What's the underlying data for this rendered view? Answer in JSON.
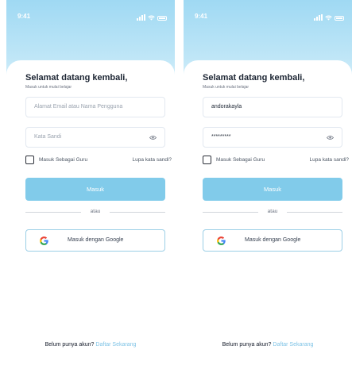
{
  "screens": [
    {
      "status_time": "9:41",
      "title": "Selamat datang kembali,",
      "subtitle": "Masuk untuk mulai belajar",
      "email_value": "",
      "email_placeholder": "Alamat Email atau Nama Pengguna",
      "password_value": "",
      "password_placeholder": "Kata Sandi",
      "teacher_label": "Masuk Sebagai Guru",
      "forgot_label": "Lupa kata sandi?",
      "login_label": "Masuk",
      "or_label": "atau",
      "google_label": "Masuk dengan Google",
      "no_account_text": "Belum punya akun?",
      "register_link": "Daftar Sekarang"
    },
    {
      "status_time": "9:41",
      "title": "Selamat datang kembali,",
      "subtitle": "Masuk untuk mulai belajar",
      "email_value": "andorakayla",
      "email_placeholder": "",
      "password_value": "*********",
      "password_placeholder": "",
      "teacher_label": "Masuk Sebagai Guru",
      "forgot_label": "Lupa kata sandi?",
      "login_label": "Masuk",
      "or_label": "atau",
      "google_label": "Masuk dengan Google",
      "no_account_text": "Belum punya akun?",
      "register_link": "Daftar Sekarang"
    }
  ],
  "colors": {
    "accent": "#81cbea",
    "link": "#7ec3e6",
    "header_gradient_top": "#9fd9f3"
  }
}
